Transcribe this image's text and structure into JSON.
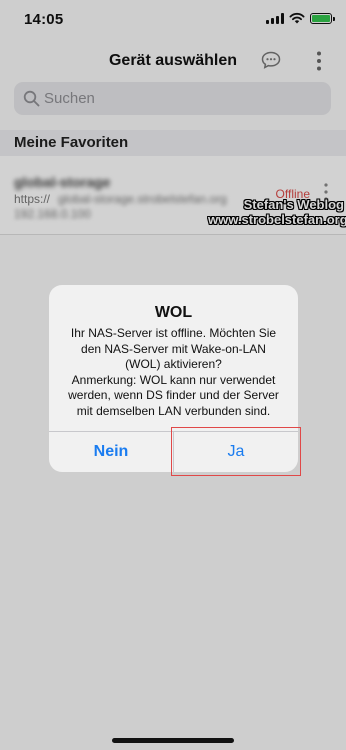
{
  "status_bar": {
    "time": "14:05",
    "signal_icon": "signal-icon",
    "wifi_icon": "wifi-icon",
    "battery_icon": "battery-icon",
    "battery_color": "#33c24d"
  },
  "nav": {
    "title": "Gerät auswählen",
    "chat_icon": "chat-bubble-icon",
    "more_icon": "more-vertical-icon"
  },
  "search": {
    "placeholder": "Suchen",
    "icon": "search-icon"
  },
  "favorites": {
    "section_title": "Meine Favoriten",
    "items": [
      {
        "name": "global-storage",
        "url_prefix": "https://",
        "url_rest": "global-storage.strobelstefan.org",
        "url_line2": "192.168.0.100",
        "status": "Offline"
      }
    ]
  },
  "watermark": {
    "line1": "Stefan's Weblog",
    "line2": "www.strobelstefan.org"
  },
  "alert": {
    "title": "WOL",
    "message": "Ihr NAS-Server ist offline. Möchten Sie\nden NAS-Server mit Wake-on-LAN\n(WOL) aktivieren?\nAnmerkung: WOL kann nur verwendet\nwerden, wenn DS finder und der Server\nmit demselben LAN verbunden sind.",
    "no_label": "Nein",
    "yes_label": "Ja"
  },
  "colors": {
    "accent": "#1a7cf0",
    "offline": "#d84b48",
    "highlight": "#e04848"
  }
}
